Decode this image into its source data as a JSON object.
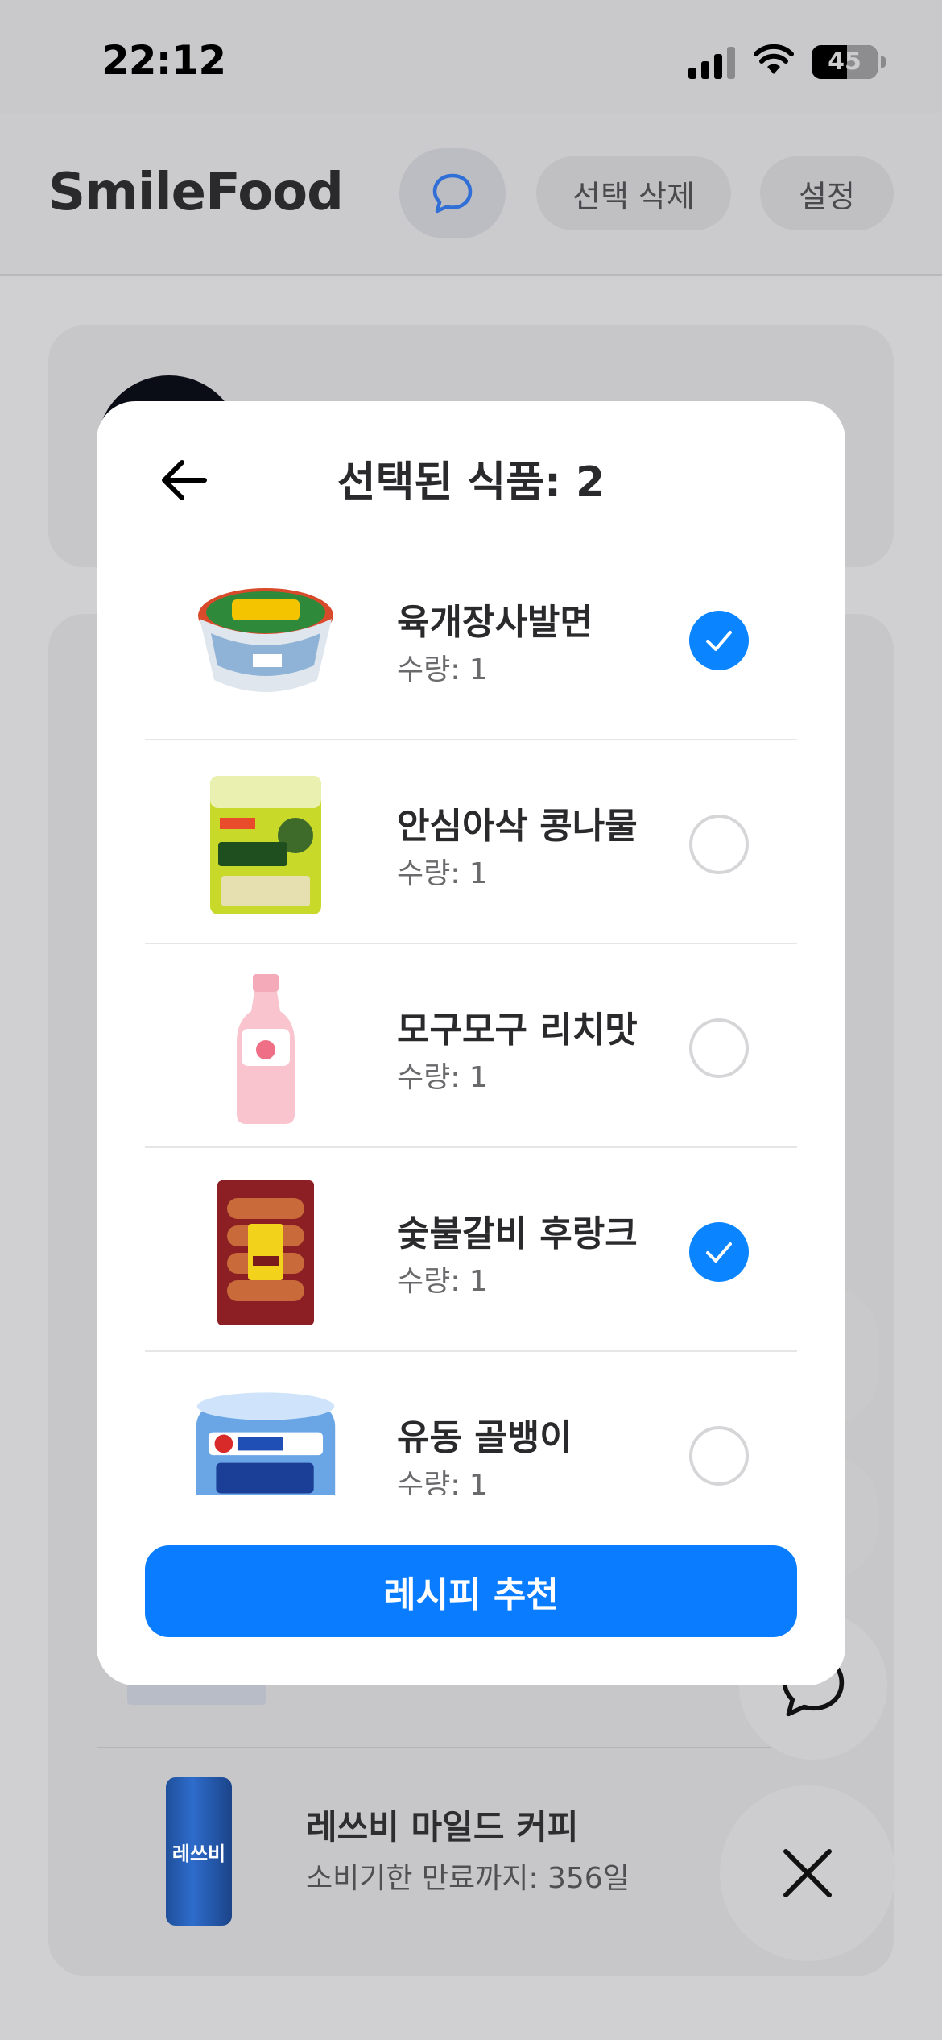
{
  "status_bar": {
    "time": "22:12",
    "battery": "45"
  },
  "app_bar": {
    "title": "SmileFood",
    "delete_selected": "선택 삭제",
    "settings": "설정"
  },
  "background_list": {
    "item_name": "레쓰비 마일드 커피",
    "item_sub": "소비기한 만료까지: 356일",
    "can_label": "레쓰비"
  },
  "modal": {
    "title": "선택된 식품: 2",
    "items": [
      {
        "name": "육개장사발면",
        "qty": "수량: 1",
        "selected": true,
        "icon": "cup-noodle-image"
      },
      {
        "name": "안심아삭 콩나물",
        "qty": "수량: 1",
        "selected": false,
        "icon": "bean-sprouts-image"
      },
      {
        "name": "모구모구 리치맛",
        "qty": "수량: 1",
        "selected": false,
        "icon": "lychee-drink-image"
      },
      {
        "name": "숯불갈비 후랑크",
        "qty": "수량: 1",
        "selected": true,
        "icon": "sausage-image"
      },
      {
        "name": "유동 골뱅이",
        "qty": "수량: 1",
        "selected": false,
        "icon": "canned-whelk-image"
      }
    ],
    "recommend_button": "레시피 추천"
  },
  "colors": {
    "accent": "#0a84ff",
    "button": "#0a7cff"
  }
}
